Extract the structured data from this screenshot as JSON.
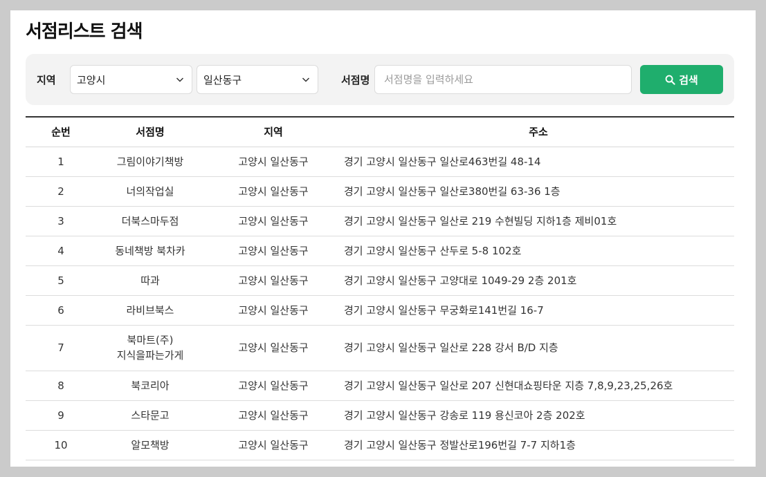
{
  "page": {
    "title": "서점리스트 검색"
  },
  "search": {
    "region_label": "지역",
    "city_value": "고양시",
    "district_value": "일산동구",
    "name_label": "서점명",
    "name_placeholder": "서점명을 입력하세요",
    "button_label": "검색"
  },
  "table": {
    "headers": [
      "순번",
      "서점명",
      "지역",
      "주소"
    ],
    "rows": [
      {
        "no": "1",
        "name": "그림이야기책방",
        "name2": "",
        "region": "고양시 일산동구",
        "address": "경기 고양시 일산동구 일산로463번길 48-14"
      },
      {
        "no": "2",
        "name": "너의작업실",
        "name2": "",
        "region": "고양시 일산동구",
        "address": "경기 고양시 일산동구 일산로380번길 63-36 1층"
      },
      {
        "no": "3",
        "name": "더북스마두점",
        "name2": "",
        "region": "고양시 일산동구",
        "address": "경기 고양시 일산동구 일산로 219 수현빌딩 지하1층 제비01호"
      },
      {
        "no": "4",
        "name": "동네책방 북차카",
        "name2": "",
        "region": "고양시 일산동구",
        "address": "경기 고양시 일산동구 산두로 5-8 102호"
      },
      {
        "no": "5",
        "name": "따과",
        "name2": "",
        "region": "고양시 일산동구",
        "address": "경기 고양시 일산동구 고양대로 1049-29 2층 201호"
      },
      {
        "no": "6",
        "name": "라비브북스",
        "name2": "",
        "region": "고양시 일산동구",
        "address": "경기 고양시 일산동구 무궁화로141번길 16-7"
      },
      {
        "no": "7",
        "name": "북마트(주)",
        "name2": "지식을파는가게",
        "region": "고양시 일산동구",
        "address": "경기 고양시 일산동구 일산로 228 강서 B/D 지층"
      },
      {
        "no": "8",
        "name": "북코리아",
        "name2": "",
        "region": "고양시 일산동구",
        "address": "경기 고양시 일산동구 일산로 207 신현대쇼핑타운 지층 7,8,9,23,25,26호"
      },
      {
        "no": "9",
        "name": "스타문고",
        "name2": "",
        "region": "고양시 일산동구",
        "address": "경기 고양시 일산동구 강송로 119 용신코아 2층 202호"
      },
      {
        "no": "10",
        "name": "알모책방",
        "name2": "",
        "region": "고양시 일산동구",
        "address": "경기 고양시 일산동구 정발산로196번길 7-7 지하1층"
      }
    ]
  }
}
